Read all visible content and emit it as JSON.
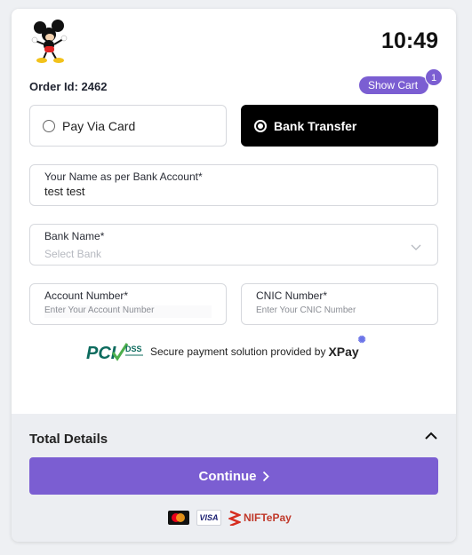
{
  "header": {
    "time": "10:49",
    "order_label": "Order Id: 2462",
    "show_cart_label": "Show Cart",
    "cart_count": "1"
  },
  "payment_options": {
    "card_label": "Pay Via Card",
    "bank_label": "Bank Transfer",
    "selected": "Bank Transfer"
  },
  "form": {
    "name_label": "Your Name as per Bank Account*",
    "name_value": "test test",
    "bank_label": "Bank Name*",
    "bank_placeholder": "Select Bank",
    "account_label": "Account Number*",
    "account_placeholder": "Enter Your Account Number",
    "cnic_label": "CNIC Number*",
    "cnic_placeholder": "Enter Your CNIC Number"
  },
  "security": {
    "text": "Secure payment solution provided by",
    "brand": "XPay",
    "pci_text": "PCI",
    "dss_text": "DSS"
  },
  "footer": {
    "total_label": "Total Details",
    "continue_label": "Continue",
    "visa_text": "VISA",
    "nift_text": "NIFTePay"
  },
  "colors": {
    "accent": "#7b5ed2",
    "selected_bg": "#000000",
    "bottom_bg": "#eceef2"
  },
  "icons": [
    "mickey-logo-icon",
    "radio-unchecked-icon",
    "radio-checked-icon",
    "chevron-down-icon",
    "chevron-up-icon",
    "chevron-right-icon",
    "pci-dss-icon",
    "mastercard-icon",
    "visa-icon",
    "nift-epay-icon"
  ]
}
